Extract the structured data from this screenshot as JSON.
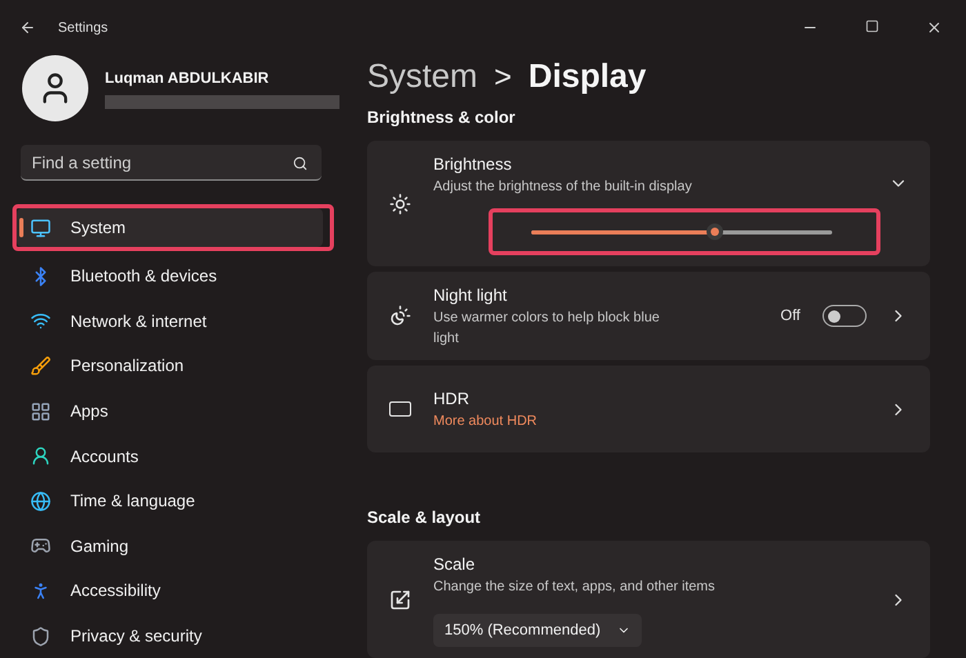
{
  "window": {
    "title": "Settings"
  },
  "user": {
    "name": "Luqman ABDULKABIR"
  },
  "search": {
    "placeholder": "Find a setting"
  },
  "sidebar": {
    "items": [
      {
        "label": "System",
        "selected": true
      },
      {
        "label": "Bluetooth & devices",
        "selected": false
      },
      {
        "label": "Network & internet",
        "selected": false
      },
      {
        "label": "Personalization",
        "selected": false
      },
      {
        "label": "Apps",
        "selected": false
      },
      {
        "label": "Accounts",
        "selected": false
      },
      {
        "label": "Time & language",
        "selected": false
      },
      {
        "label": "Gaming",
        "selected": false
      },
      {
        "label": "Accessibility",
        "selected": false
      },
      {
        "label": "Privacy & security",
        "selected": false
      }
    ]
  },
  "breadcrumb": {
    "parent": "System",
    "separator": ">",
    "current": "Display"
  },
  "sections": [
    {
      "heading": "Brightness & color",
      "cards": [
        {
          "kind": "slider",
          "title": "Brightness",
          "description": "Adjust the brightness of the built-in display",
          "expanded": true,
          "level": 0.61
        },
        {
          "kind": "toggle",
          "title": "Night light",
          "description": "Use warmer colors to help block blue light",
          "state": "Off",
          "on": false
        },
        {
          "kind": "link",
          "title": "HDR",
          "link": "More about HDR"
        }
      ]
    },
    {
      "heading": "Scale & layout",
      "cards": [
        {
          "kind": "dropdown",
          "title": "Scale",
          "description": "Change the size of text, apps, and other items",
          "value": "150% (Recommended)"
        }
      ]
    }
  ]
}
